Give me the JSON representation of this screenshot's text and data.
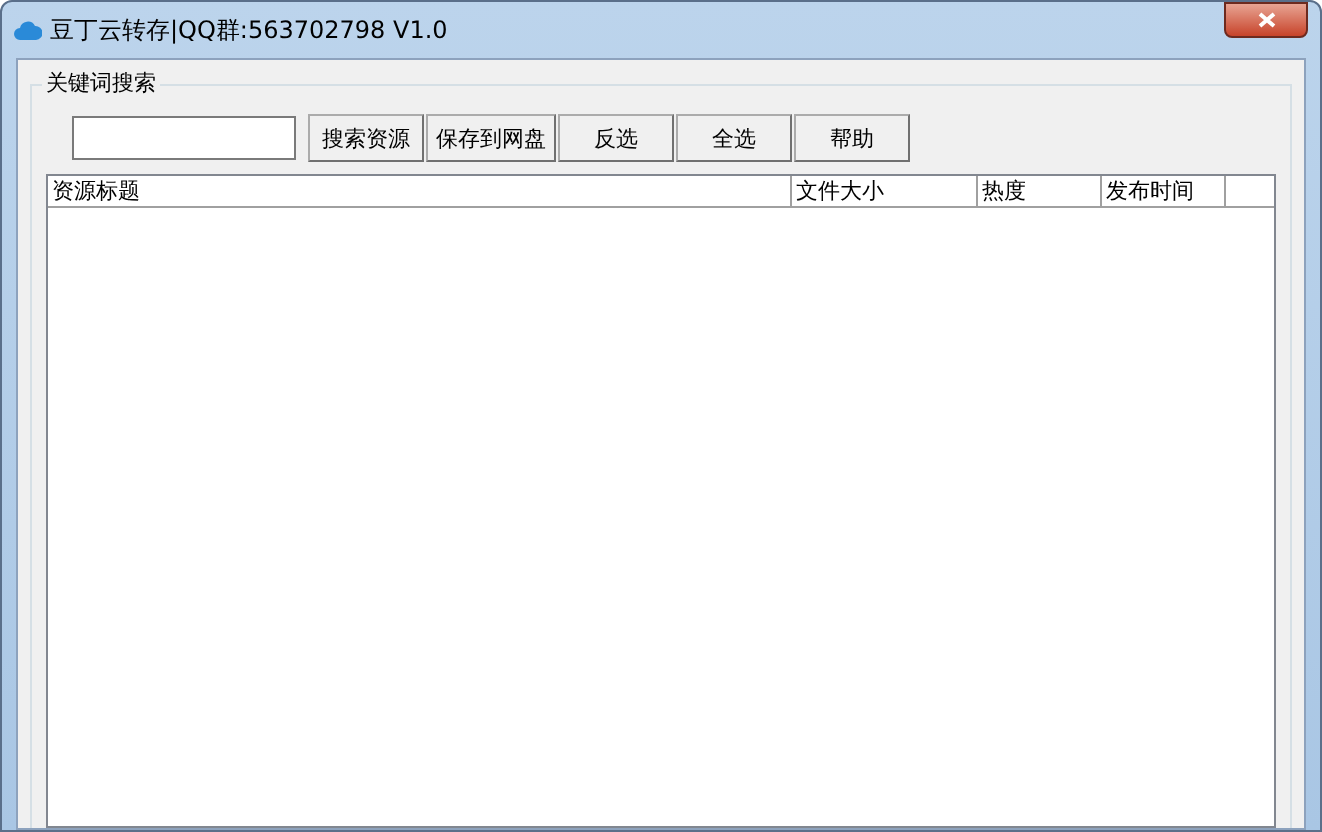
{
  "window": {
    "title": "豆丁云转存|QQ群:563702798  V1.0"
  },
  "group": {
    "title": "关键词搜索"
  },
  "buttons": [
    "搜索资源",
    "保存到网盘",
    "反选",
    "全选",
    "帮助"
  ],
  "table": {
    "columns": [
      "资源标题",
      "文件大小",
      "热度",
      "发布时间"
    ]
  }
}
